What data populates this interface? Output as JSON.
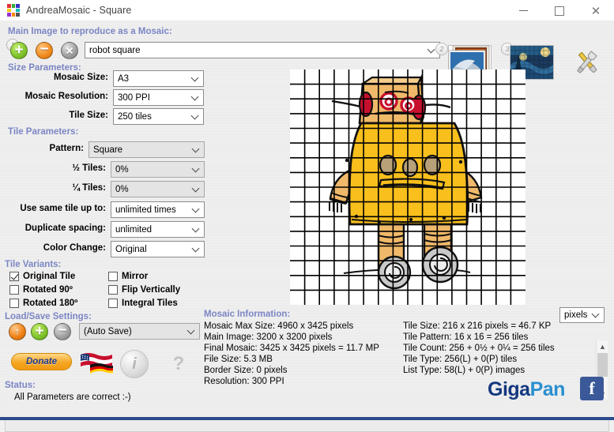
{
  "window": {
    "title": "AndreaMosaic - Square",
    "minimize_label": "minimize",
    "maximize_label": "maximize",
    "close_label": "✕"
  },
  "main_image": {
    "section_title": "Main Image to reproduce as a Mosaic:",
    "add_label": "+",
    "remove_label": "−",
    "clear_label": "✕",
    "value": "robot square"
  },
  "size_parameters": {
    "section_title": "Size Parameters:",
    "fields": [
      {
        "label": "Mosaic Size:",
        "value": "A3"
      },
      {
        "label": "Mosaic Resolution:",
        "value": "300 PPI"
      },
      {
        "label": "Tile Size:",
        "value": "250 tiles"
      }
    ]
  },
  "tile_parameters": {
    "section_title": "Tile Parameters:",
    "fields": [
      {
        "label": "Pattern:",
        "value": "Square"
      },
      {
        "label": "½ Tiles:",
        "value": "0%"
      },
      {
        "label": "¼ Tiles:",
        "value": "0%"
      },
      {
        "label": "Use same tile up to:",
        "value": "unlimited times"
      },
      {
        "label": "Duplicate spacing:",
        "value": "unlimited"
      },
      {
        "label": "Color Change:",
        "value": "Original"
      }
    ]
  },
  "tile_variants": {
    "section_title": "Tile Variants:",
    "items": [
      {
        "label": "Original Tile",
        "checked": true
      },
      {
        "label": "Rotated 90º",
        "checked": false
      },
      {
        "label": "Rotated 180º",
        "checked": false
      },
      {
        "label": "Mirror",
        "checked": false
      },
      {
        "label": "Flip Vertically",
        "checked": false
      },
      {
        "label": "Integral Tiles",
        "checked": false
      }
    ]
  },
  "load_save": {
    "section_title": "Load/Save Settings:",
    "load_label": "↑",
    "add_label": "+",
    "remove_label": "−",
    "value": "(Auto Save)",
    "donate_label": "Donate",
    "flag_label": "language-flags",
    "info_label": "i",
    "help_label": "?"
  },
  "status": {
    "section_title": "Status:",
    "message": "All Parameters are correct :-)"
  },
  "mosaic_information": {
    "section_title": "Mosaic Information:",
    "units_value": "pixels",
    "left_lines": [
      "Mosaic Max Size: 4960 x 3425 pixels",
      "Main Image: 3200 x 3200 pixels",
      "Final Mosaic: 3425 x 3425 pixels = 11.7 MP",
      "File Size: 5.3 MB",
      "Border Size: 0 pixels",
      "Resolution: 300 PPI"
    ],
    "right_lines": [
      "Tile Size: 216 x 216 pixels = 46.7 KP",
      "Tile Pattern: 16 x 16 = 256 tiles",
      "Tile Count: 256 + 0½ + 0¼ = 256 tiles",
      "Tile Type: 256(L) + 0(P) tiles",
      "List Type: 58(L) + 0(P) images"
    ]
  },
  "toolbar": {
    "tiles_thumb_label": "tile-images-thumbnail",
    "mosaic_thumb_label": "mosaic-result-thumbnail",
    "tools_label": "tools"
  },
  "branding": {
    "giga": "Giga",
    "pan": "Pan",
    "facebook": "f"
  },
  "preview": {
    "grid": 16,
    "alt": "robot square main image with mosaic tile grid"
  },
  "colors": {
    "section_heading": "#7b86c4",
    "robot_body": "#f9bf1c",
    "robot_limb": "#f0b96a",
    "robot_eye": "#c8102e",
    "gigapan_dark": "#14387f",
    "gigapan_light": "#2a8fd0",
    "facebook": "#3b5998"
  }
}
